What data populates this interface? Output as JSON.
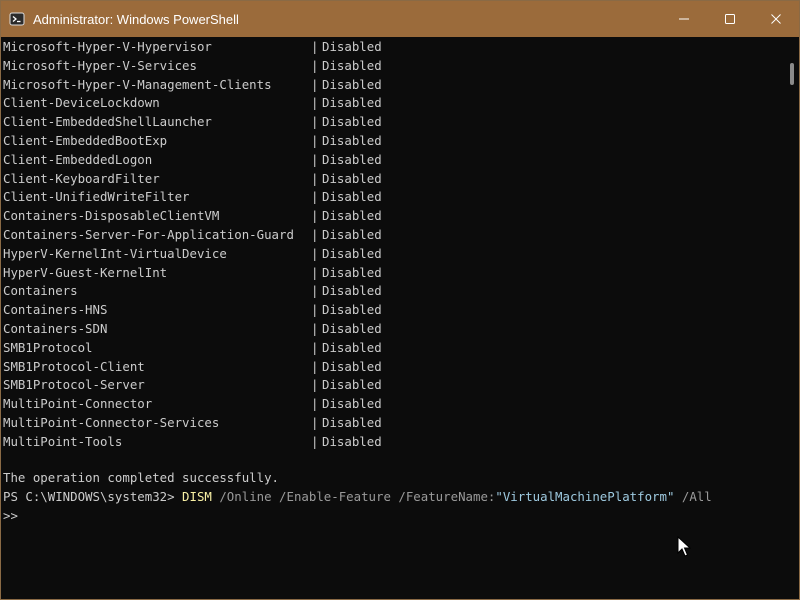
{
  "window": {
    "title": "Administrator: Windows PowerShell",
    "app_icon": "powershell-icon",
    "minimize_icon": "minimize-icon",
    "maximize_icon": "maximize-icon",
    "close_icon": "close-icon",
    "titlebar_color": "#9b6b3b",
    "terminal_bg": "#0c0c0c"
  },
  "features": [
    {
      "name": "Microsoft-Hyper-V-Hypervisor",
      "sep": "|",
      "state": "Disabled"
    },
    {
      "name": "Microsoft-Hyper-V-Services",
      "sep": "|",
      "state": "Disabled"
    },
    {
      "name": "Microsoft-Hyper-V-Management-Clients",
      "sep": "|",
      "state": "Disabled"
    },
    {
      "name": "Client-DeviceLockdown",
      "sep": "|",
      "state": "Disabled"
    },
    {
      "name": "Client-EmbeddedShellLauncher",
      "sep": "|",
      "state": "Disabled"
    },
    {
      "name": "Client-EmbeddedBootExp",
      "sep": "|",
      "state": "Disabled"
    },
    {
      "name": "Client-EmbeddedLogon",
      "sep": "|",
      "state": "Disabled"
    },
    {
      "name": "Client-KeyboardFilter",
      "sep": "|",
      "state": "Disabled"
    },
    {
      "name": "Client-UnifiedWriteFilter",
      "sep": "|",
      "state": "Disabled"
    },
    {
      "name": "Containers-DisposableClientVM",
      "sep": "|",
      "state": "Disabled"
    },
    {
      "name": "Containers-Server-For-Application-Guard",
      "sep": "|",
      "state": "Disabled"
    },
    {
      "name": "HyperV-KernelInt-VirtualDevice",
      "sep": "|",
      "state": "Disabled"
    },
    {
      "name": "HyperV-Guest-KernelInt",
      "sep": "|",
      "state": "Disabled"
    },
    {
      "name": "Containers",
      "sep": "|",
      "state": "Disabled"
    },
    {
      "name": "Containers-HNS",
      "sep": "|",
      "state": "Disabled"
    },
    {
      "name": "Containers-SDN",
      "sep": "|",
      "state": "Disabled"
    },
    {
      "name": "SMB1Protocol",
      "sep": "|",
      "state": "Disabled"
    },
    {
      "name": "SMB1Protocol-Client",
      "sep": "|",
      "state": "Disabled"
    },
    {
      "name": "SMB1Protocol-Server",
      "sep": "|",
      "state": "Disabled"
    },
    {
      "name": "MultiPoint-Connector",
      "sep": "|",
      "state": "Disabled"
    },
    {
      "name": "MultiPoint-Connector-Services",
      "sep": "|",
      "state": "Disabled"
    },
    {
      "name": "MultiPoint-Tools",
      "sep": "|",
      "state": "Disabled"
    }
  ],
  "output": {
    "success_message": "The operation completed successfully."
  },
  "prompt": {
    "path": "PS C:\\WINDOWS\\system32> ",
    "command": "DISM",
    "args1": " /Online /Enable-Feature /FeatureName:",
    "string_arg": "\"VirtualMachinePlatform\"",
    "args2": " /All",
    "continuation": ">>"
  },
  "colors": {
    "text": "#cccccc",
    "command": "#f9f1a5",
    "parameter": "#9a9a9a",
    "string": "#9ecae0"
  }
}
